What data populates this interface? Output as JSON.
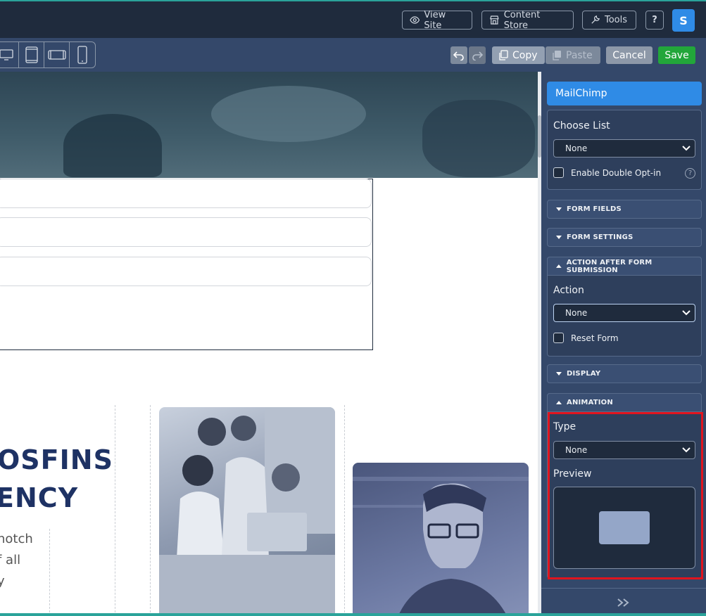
{
  "topbar": {
    "view_site": "View Site",
    "content_store": "Content Store",
    "tools": "Tools",
    "help": "?",
    "avatar_initial": "S"
  },
  "toolbar": {
    "copy": "Copy",
    "paste": "Paste",
    "cancel": "Cancel",
    "save": "Save"
  },
  "canvas": {
    "headline_1": "OSFINS",
    "headline_2": "ENCY",
    "body_lines": [
      "notch",
      "f all",
      "y"
    ]
  },
  "panel": {
    "widget_title": "MailChimp",
    "choose_list_label": "Choose List",
    "choose_list_value": "None",
    "double_optin_label": "Enable Double Opt-in",
    "help_icon": "?",
    "sections": {
      "form_fields": "FORM FIELDS",
      "form_settings": "FORM SETTINGS",
      "action_after": "ACTION AFTER FORM SUBMISSION",
      "display": "DISPLAY",
      "animation": "ANIMATION"
    },
    "action_label": "Action",
    "action_value": "None",
    "reset_form_label": "Reset Form",
    "type_label": "Type",
    "type_value": "None",
    "preview_label": "Preview"
  },
  "colors": {
    "accent": "#2f8be6",
    "save_green": "#22a63a",
    "highlight_red": "#e0141e",
    "panel_bg": "#34486a",
    "topbar_bg": "#1f2b3d"
  }
}
